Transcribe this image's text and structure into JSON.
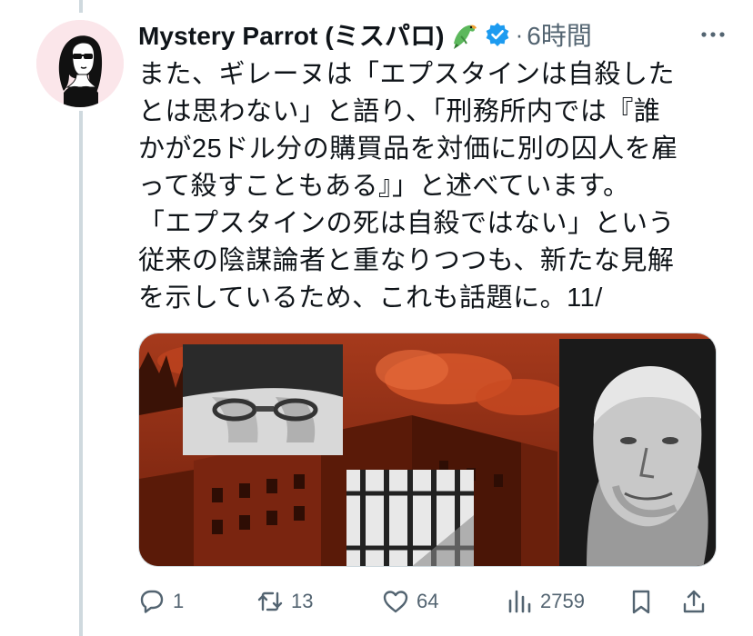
{
  "author": {
    "display_name": "Mystery Parrot (ミスパロ)",
    "emoji_icon": "parrot-icon",
    "verified_icon": "verified-badge-icon",
    "separator": "·",
    "timestamp": "6時間"
  },
  "tweet": {
    "text": "また、ギレーヌは「エプスタインは自殺した\nとは思わない」と語り、「刑務所内では『誰\nかが25ドル分の購買品を対価に別の囚人を雇\nって殺すこともある』」と述べています。\n「エプスタインの死は自殺ではない」という\n従来の陰謀論者と重なりつつも、新たな見解\nを示しているため、これも話題に。11/"
  },
  "media": {
    "description_icon": "collage-image",
    "colors": {
      "background": "#8a2a12",
      "accent": "#d9572a"
    }
  },
  "actions": {
    "reply_count": "1",
    "retweet_count": "13",
    "like_count": "64",
    "view_count": "2759"
  },
  "colors": {
    "text_primary": "#0f1419",
    "text_secondary": "#536471",
    "verified": "#1d9bf0",
    "thread_line": "#cfd9de"
  }
}
